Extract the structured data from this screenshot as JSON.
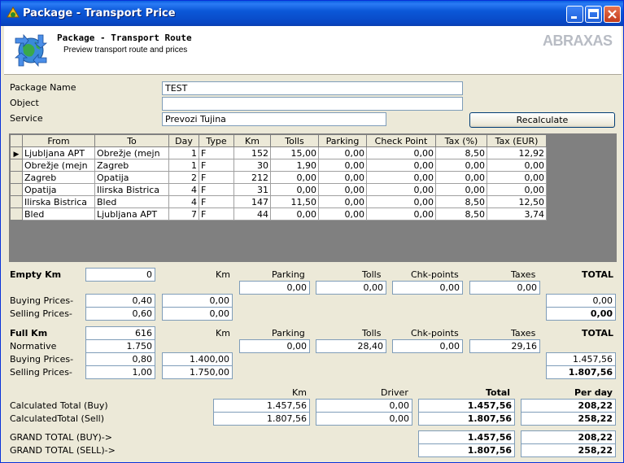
{
  "window": {
    "title": "Package - Transport Price"
  },
  "header": {
    "title": "Package - Transport Route",
    "subtitle": "Preview transport route and prices",
    "logo": "ABRAXAS"
  },
  "form": {
    "package_name_label": "Package Name",
    "package_name": "TEST",
    "object_label": "Object",
    "object": "",
    "service_label": "Service",
    "service": "Prevozi Tujina",
    "recalculate": "Recalculate"
  },
  "grid": {
    "columns": [
      "From",
      "To",
      "Day",
      "Type",
      "Km",
      "Tolls",
      "Parking",
      "Check Point",
      "Tax (%)",
      "Tax (EUR)"
    ],
    "rows": [
      [
        "Ljubljana APT",
        "Obrežje (mejn",
        "1",
        "F",
        "152",
        "15,00",
        "0,00",
        "0,00",
        "8,50",
        "12,92"
      ],
      [
        "Obrežje (mejn",
        "Zagreb",
        "1",
        "F",
        "30",
        "1,90",
        "0,00",
        "0,00",
        "0,00",
        "0,00"
      ],
      [
        "Zagreb",
        "Opatija",
        "2",
        "F",
        "212",
        "0,00",
        "0,00",
        "0,00",
        "0,00",
        "0,00"
      ],
      [
        "Opatija",
        "Ilirska Bistrica",
        "4",
        "F",
        "31",
        "0,00",
        "0,00",
        "0,00",
        "0,00",
        "0,00"
      ],
      [
        "Ilirska Bistrica",
        "Bled",
        "4",
        "F",
        "147",
        "11,50",
        "0,00",
        "0,00",
        "8,50",
        "12,50"
      ],
      [
        "Bled",
        "Ljubljana APT",
        "7",
        "F",
        "44",
        "0,00",
        "0,00",
        "0,00",
        "8,50",
        "3,74"
      ]
    ],
    "current_row_marker": "▶"
  },
  "empty": {
    "label": "Empty Km",
    "km_value": "0",
    "col_km": "Km",
    "col_parking": "Parking",
    "col_tolls": "Tolls",
    "col_chk": "Chk-points",
    "col_taxes": "Taxes",
    "col_total": "TOTAL",
    "parking": "0,00",
    "tolls": "0,00",
    "chk": "0,00",
    "taxes": "0,00",
    "buying_label": "Buying Prices-",
    "buying_price": "0,40",
    "buying_km": "0,00",
    "buying_total": "0,00",
    "selling_label": "Selling Prices-",
    "selling_price": "0,60",
    "selling_km": "0,00",
    "selling_total": "0,00"
  },
  "full": {
    "label": "Full Km",
    "km_value": "616",
    "normative_label": "Normative",
    "normative": "1.750",
    "col_km": "Km",
    "col_parking": "Parking",
    "col_tolls": "Tolls",
    "col_chk": "Chk-points",
    "col_taxes": "Taxes",
    "col_total": "TOTAL",
    "parking": "0,00",
    "tolls": "28,40",
    "chk": "0,00",
    "taxes": "29,16",
    "buying_label": "Buying Prices-",
    "buying_price": "0,80",
    "buying_km": "1.400,00",
    "buying_total": "1.457,56",
    "selling_label": "Selling Prices-",
    "selling_price": "1,00",
    "selling_km": "1.750,00",
    "selling_total": "1.807,56"
  },
  "calc": {
    "col_km": "Km",
    "col_driver": "Driver",
    "col_total": "Total",
    "col_perday": "Per day",
    "buy_label": "Calculated Total (Buy)",
    "buy_km": "1.457,56",
    "buy_driver": "0,00",
    "buy_total": "1.457,56",
    "buy_perday": "208,22",
    "sell_label": "CalculatedTotal (Sell)",
    "sell_km": "1.807,56",
    "sell_driver": "0,00",
    "sell_total": "1.807,56",
    "sell_perday": "258,22",
    "grand_buy_label": "GRAND TOTAL (BUY)->",
    "grand_buy_total": "1.457,56",
    "grand_buy_perday": "208,22",
    "grand_sell_label": "GRAND TOTAL (SELL)->",
    "grand_sell_total": "1.807,56",
    "grand_sell_perday": "258,22"
  }
}
